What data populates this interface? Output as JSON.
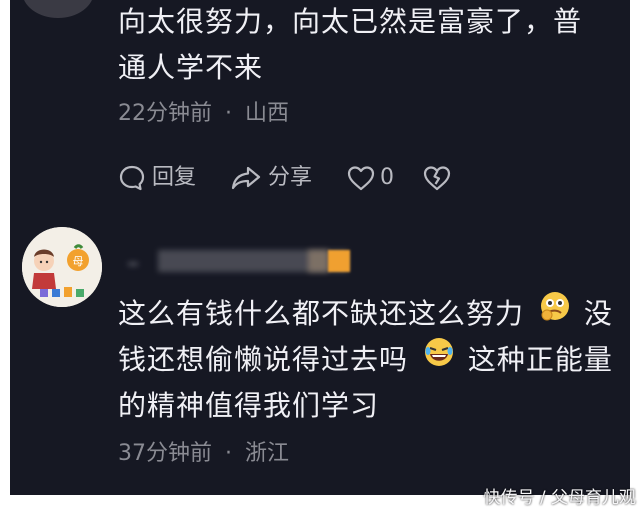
{
  "comment1": {
    "line1": "向太很努力，向太已然是富豪了，普",
    "line2": "通人学不来",
    "time": "22分钟前",
    "separator": "·",
    "location": "山西",
    "actions": {
      "reply_label": "回复",
      "share_label": "分享",
      "like_count": "0"
    }
  },
  "comment2": {
    "line1": "这么有钱什么都不缺还这么努力",
    "line2a": "没",
    "line2b": "钱还想偷懒说得过去吗",
    "line3a": "这种正能量",
    "line3b": "的精神值得我们学习",
    "time": "37分钟前",
    "separator": "·",
    "location": "浙江",
    "avatar_badge": "母"
  },
  "watermark": "快传号 / 父母育儿观",
  "colors": {
    "background": "#161823",
    "text": "#f0f0f5",
    "meta": "#8a8b93",
    "icon": "#b9bac1"
  },
  "icons": [
    "reply-bubble-icon",
    "share-arrow-icon",
    "heart-icon",
    "broken-heart-icon",
    "thinking-emoji-icon",
    "laughing-emoji-icon"
  ]
}
